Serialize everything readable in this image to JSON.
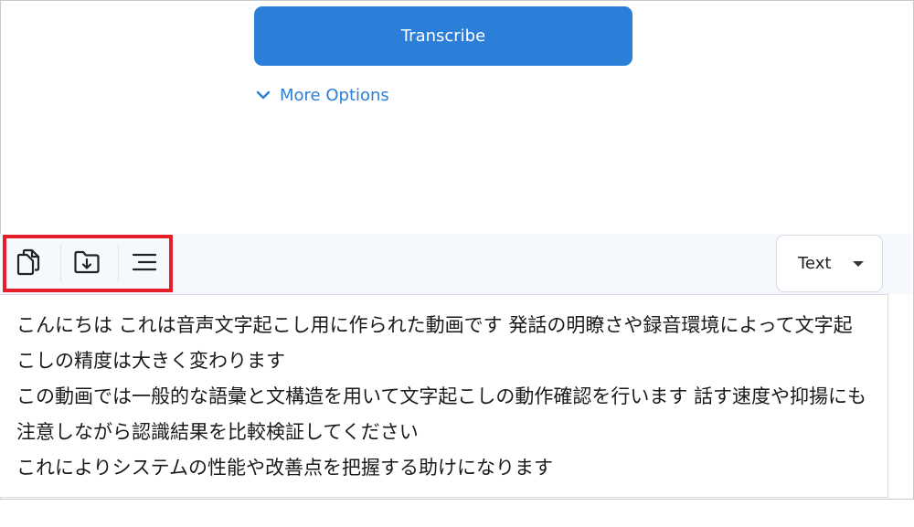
{
  "main": {
    "transcribe_label": "Transcribe",
    "more_options_label": "More Options"
  },
  "toolbar": {
    "icons": [
      "copy-icon",
      "download-folder-icon",
      "menu-lines-icon"
    ],
    "format_select": {
      "selected": "Text"
    }
  },
  "output": {
    "text": "こんにちは これは音声文字起こし用に作られた動画です 発話の明瞭さや録音環境によって文字起こしの精度は大きく変わります\nこの動画では一般的な語彙と文構造を用いて文字起こしの動作確認を行います 話す速度や抑揚にも注意しながら認識結果を比較検証してください\nこれによりシステムの性能や改善点を把握する助けになります"
  },
  "colors": {
    "accent": "#2b7fd8",
    "highlight": "#e41e26",
    "toolbar_bg": "#f5f8fd"
  }
}
